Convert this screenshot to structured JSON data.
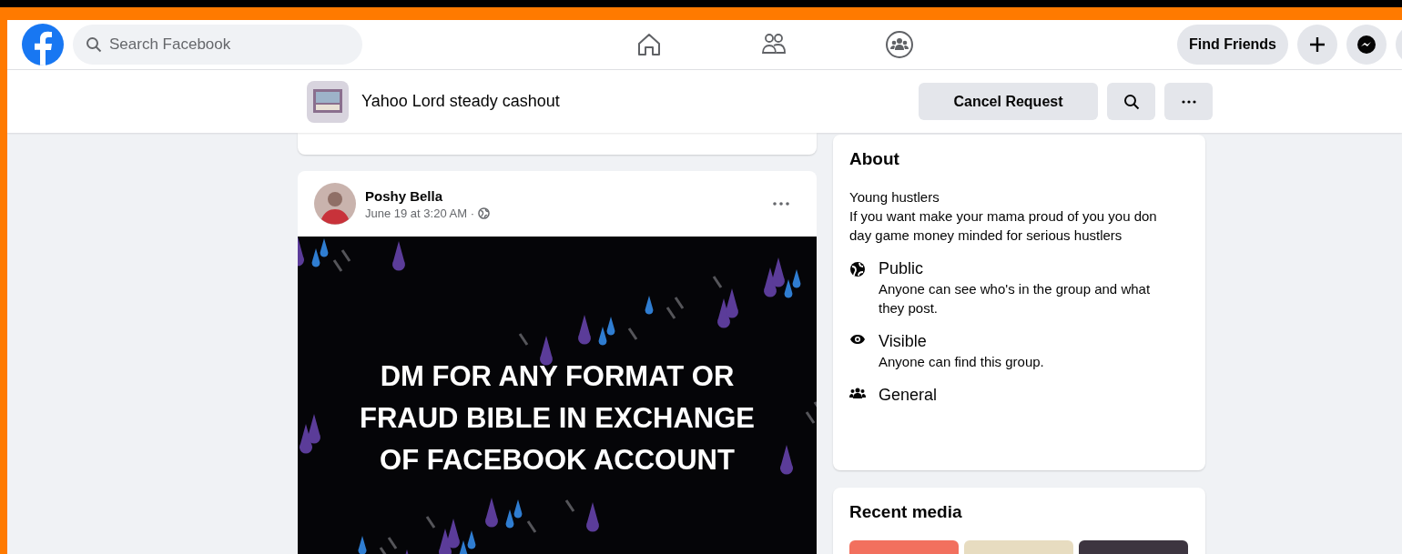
{
  "top_bar": {
    "search": {
      "placeholder": "Search Facebook"
    },
    "find_friends": "Find Friends"
  },
  "group_bar": {
    "title": "Yahoo Lord steady cashout",
    "button": "Cancel Request"
  },
  "post": {
    "author": "Poshy Bella",
    "time": "June 19 at 3:20 AM ·",
    "text": "DM FOR ANY FORMAT OR FRAUD BIBLE IN EXCHANGE OF FACEBOOK ACCOUNT"
  },
  "about": {
    "title": "About",
    "lines": [
      "Young hustlers",
      "If you want make your mama proud of you you don day game money minded for serious hustlers"
    ],
    "items": [
      {
        "kind": "public",
        "label": "Public",
        "detail": "Anyone can see who's in the group and what they post."
      },
      {
        "kind": "visible",
        "label": "Visible",
        "detail": "Anyone can find this group."
      },
      {
        "kind": "general",
        "label": "General"
      }
    ]
  },
  "recent_media": {
    "title": "Recent media"
  }
}
